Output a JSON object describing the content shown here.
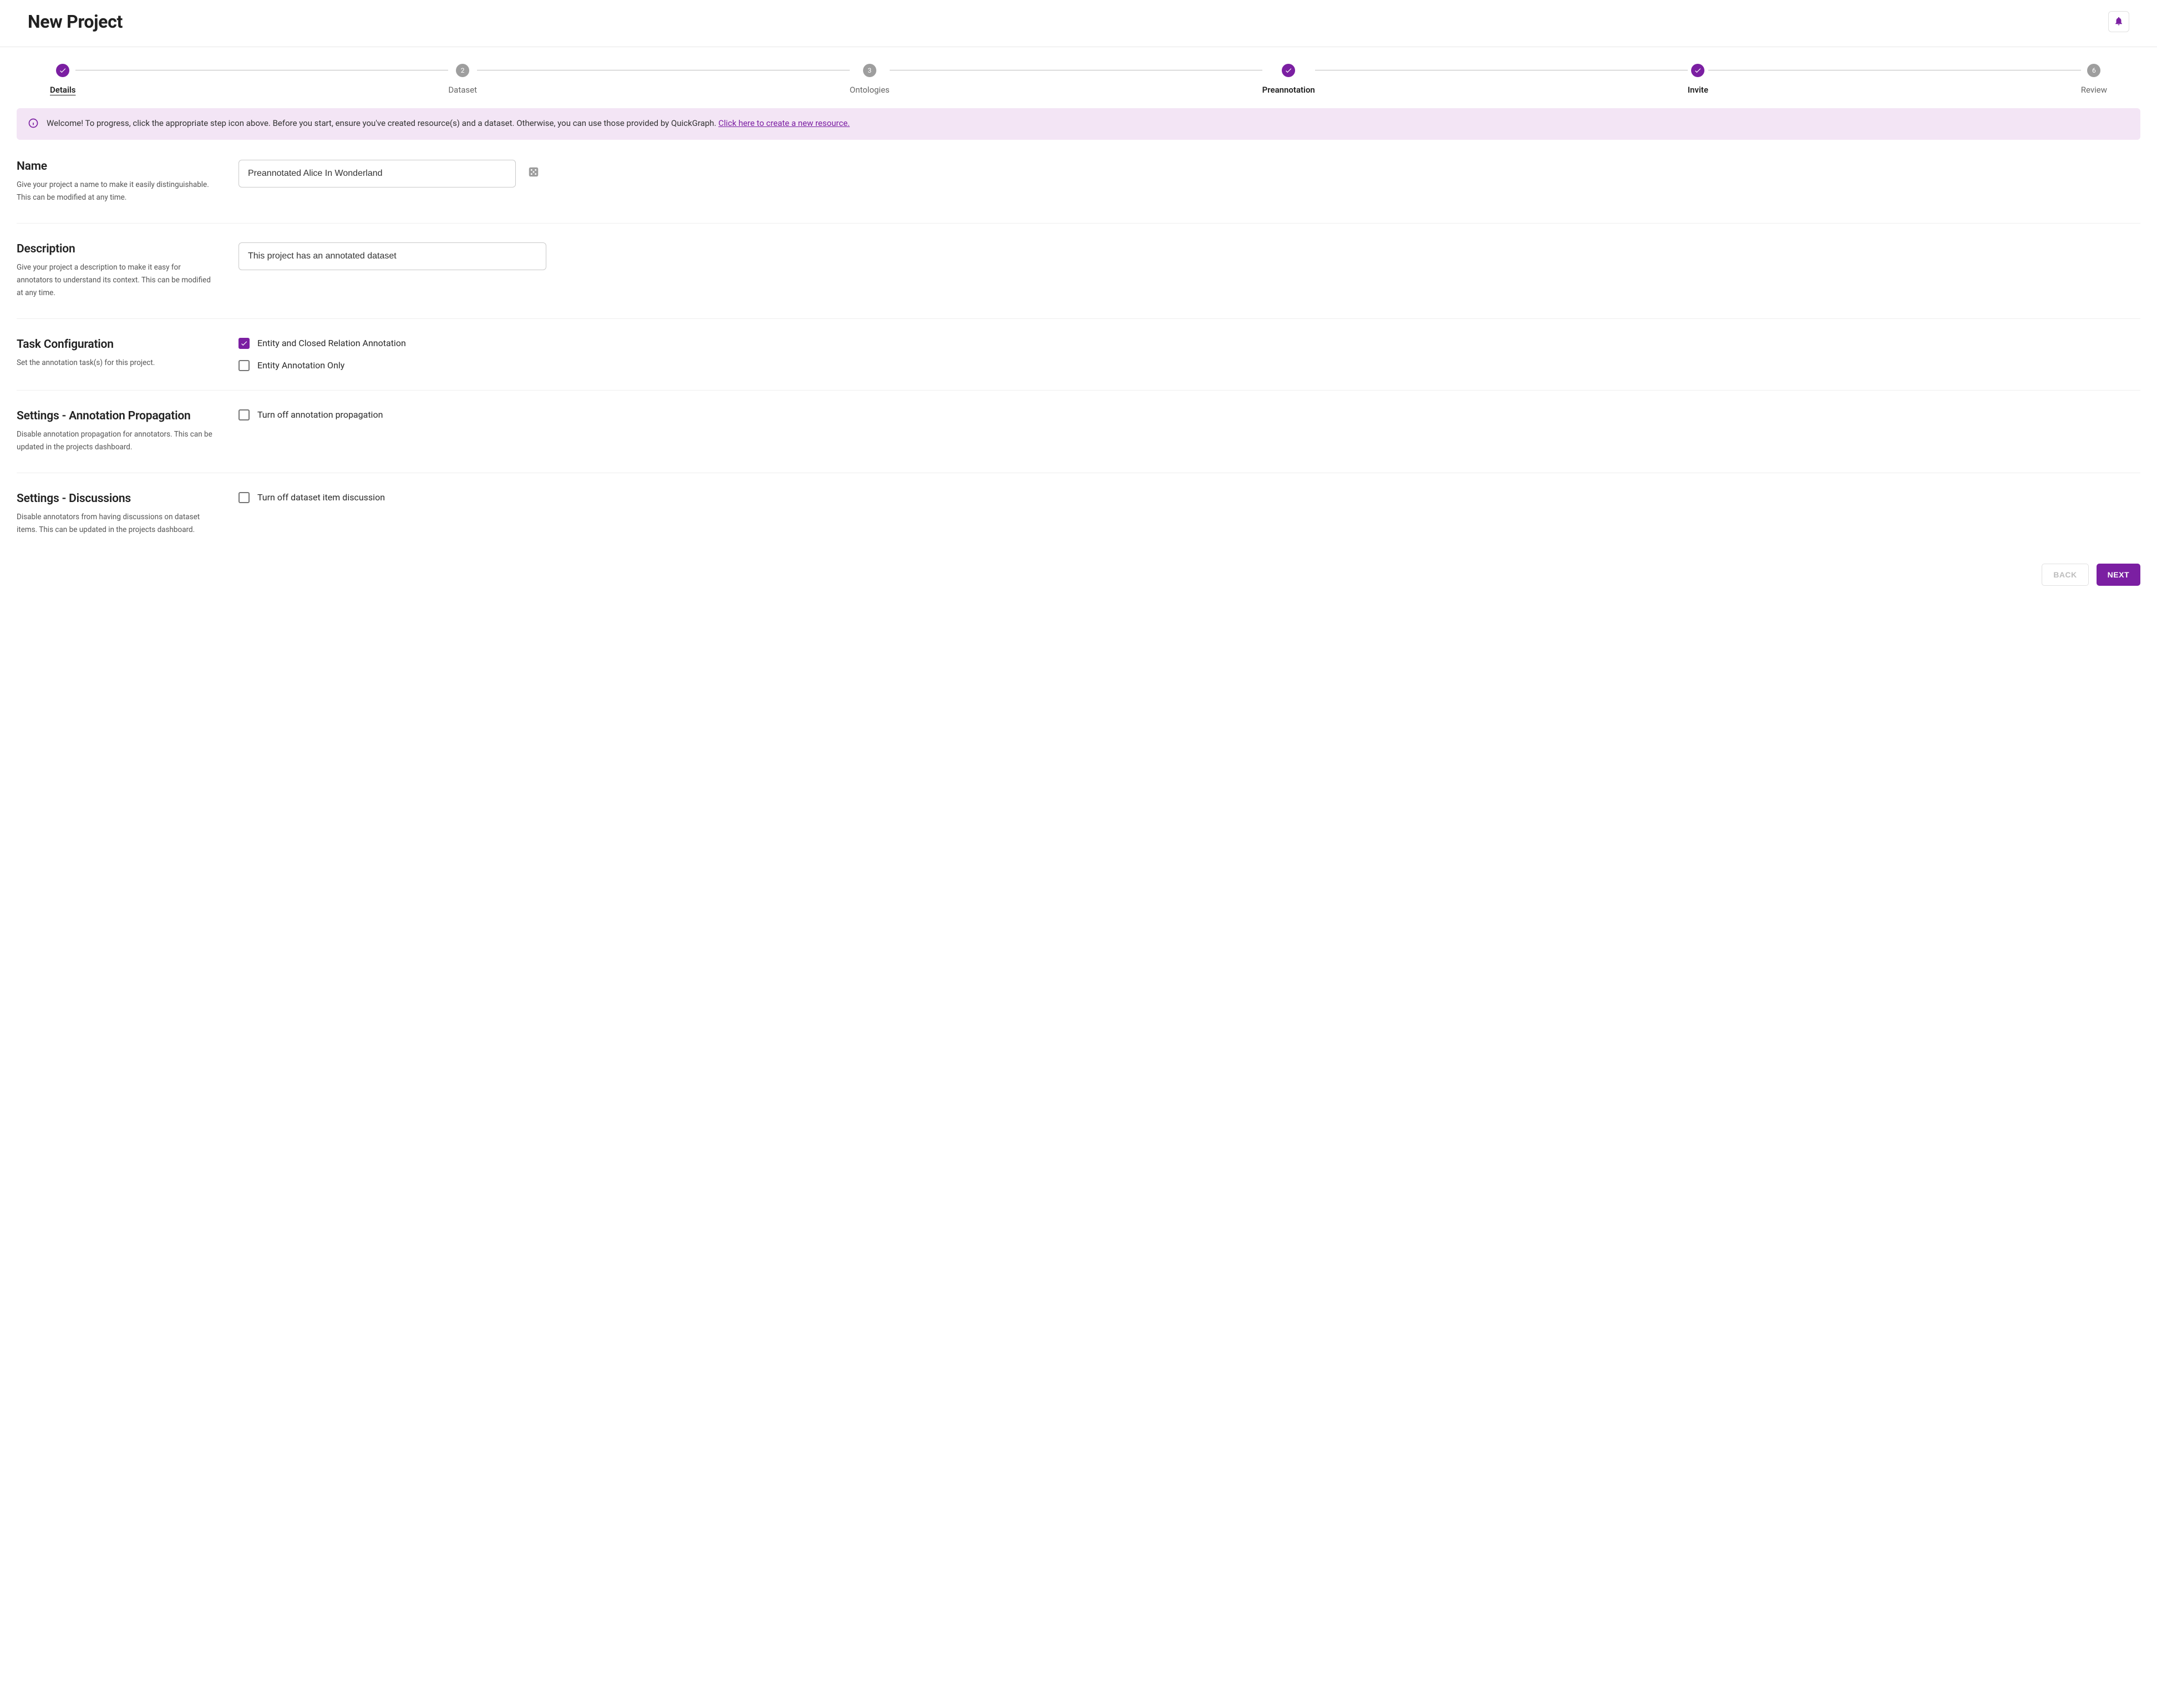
{
  "header": {
    "title": "New Project"
  },
  "stepper": {
    "steps": [
      {
        "label": "Details",
        "state": "active-completed"
      },
      {
        "label": "Dataset",
        "state": "pending",
        "num": "2"
      },
      {
        "label": "Ontologies",
        "state": "pending",
        "num": "3"
      },
      {
        "label": "Preannotation",
        "state": "completed"
      },
      {
        "label": "Invite",
        "state": "completed"
      },
      {
        "label": "Review",
        "state": "pending",
        "num": "6"
      }
    ]
  },
  "banner": {
    "text": "Welcome! To progress, click the appropriate step icon above. Before you start, ensure you've created resource(s) and a dataset. Otherwise, you can use those provided by QuickGraph. ",
    "link": "Click here to create a new resource."
  },
  "sections": {
    "name": {
      "title": "Name",
      "desc": "Give your project a name to make it easily distinguishable. This can be modified at any time.",
      "value": "Preannotated Alice In Wonderland"
    },
    "description": {
      "title": "Description",
      "desc": "Give your project a description to make it easy for annotators to understand its context. This can be modified at any time.",
      "value": "This project has an annotated dataset"
    },
    "task": {
      "title": "Task Configuration",
      "desc": "Set the annotation task(s) for this project.",
      "options": [
        {
          "label": "Entity and Closed Relation Annotation",
          "checked": true
        },
        {
          "label": "Entity Annotation Only",
          "checked": false
        }
      ]
    },
    "propagation": {
      "title": "Settings - Annotation Propagation",
      "desc": "Disable annotation propagation for annotators. This can be updated in the projects dashboard.",
      "option": {
        "label": "Turn off annotation propagation",
        "checked": false
      }
    },
    "discussions": {
      "title": "Settings - Discussions",
      "desc": "Disable annotators from having discussions on dataset items. This can be updated in the projects dashboard.",
      "option": {
        "label": "Turn off dataset item discussion",
        "checked": false
      }
    }
  },
  "footer": {
    "back": "Back",
    "next": "Next"
  }
}
